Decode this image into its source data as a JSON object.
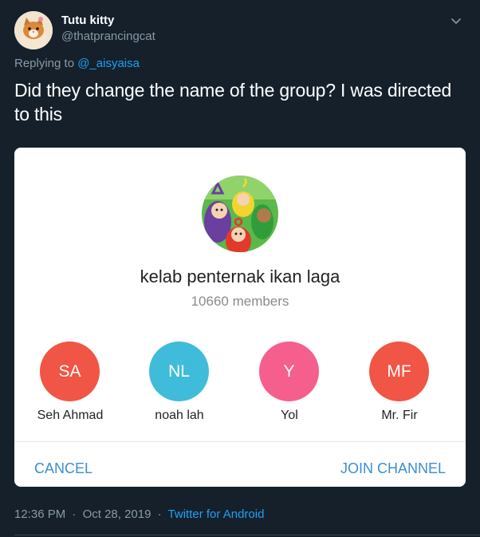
{
  "tweet": {
    "display_name": "Tutu kitty",
    "handle": "@thatprancingcat",
    "replying_prefix": "Replying to",
    "replying_mention": "@_aisyaisa",
    "text": "Did they change the name of the group? I was directed to this",
    "time": "12:36 PM",
    "separator": "·",
    "date": "Oct 28, 2019",
    "source": "Twitter for Android"
  },
  "card": {
    "group_name": "kelab penternak ikan laga",
    "member_count": "10660 members",
    "members": [
      {
        "initials": "SA",
        "name": "Seh Ahmad",
        "color": "#f05545"
      },
      {
        "initials": "NL",
        "name": "noah lah",
        "color": "#3fbcd9"
      },
      {
        "initials": "Y",
        "name": "Yol",
        "color": "#f55f8e"
      },
      {
        "initials": "MF",
        "name": "Mr. Fir",
        "color": "#f05545"
      }
    ],
    "cancel_label": "CANCEL",
    "join_label": "JOIN CHANNEL"
  },
  "colors": {
    "background": "#15202b",
    "link": "#1da1f2",
    "muted": "#8899a6",
    "accent_button": "#3a8fd1"
  },
  "icons": {
    "more": "chevron-down-icon",
    "avatar": "cat-avatar",
    "group_photo": "teletubbies-group-photo"
  }
}
